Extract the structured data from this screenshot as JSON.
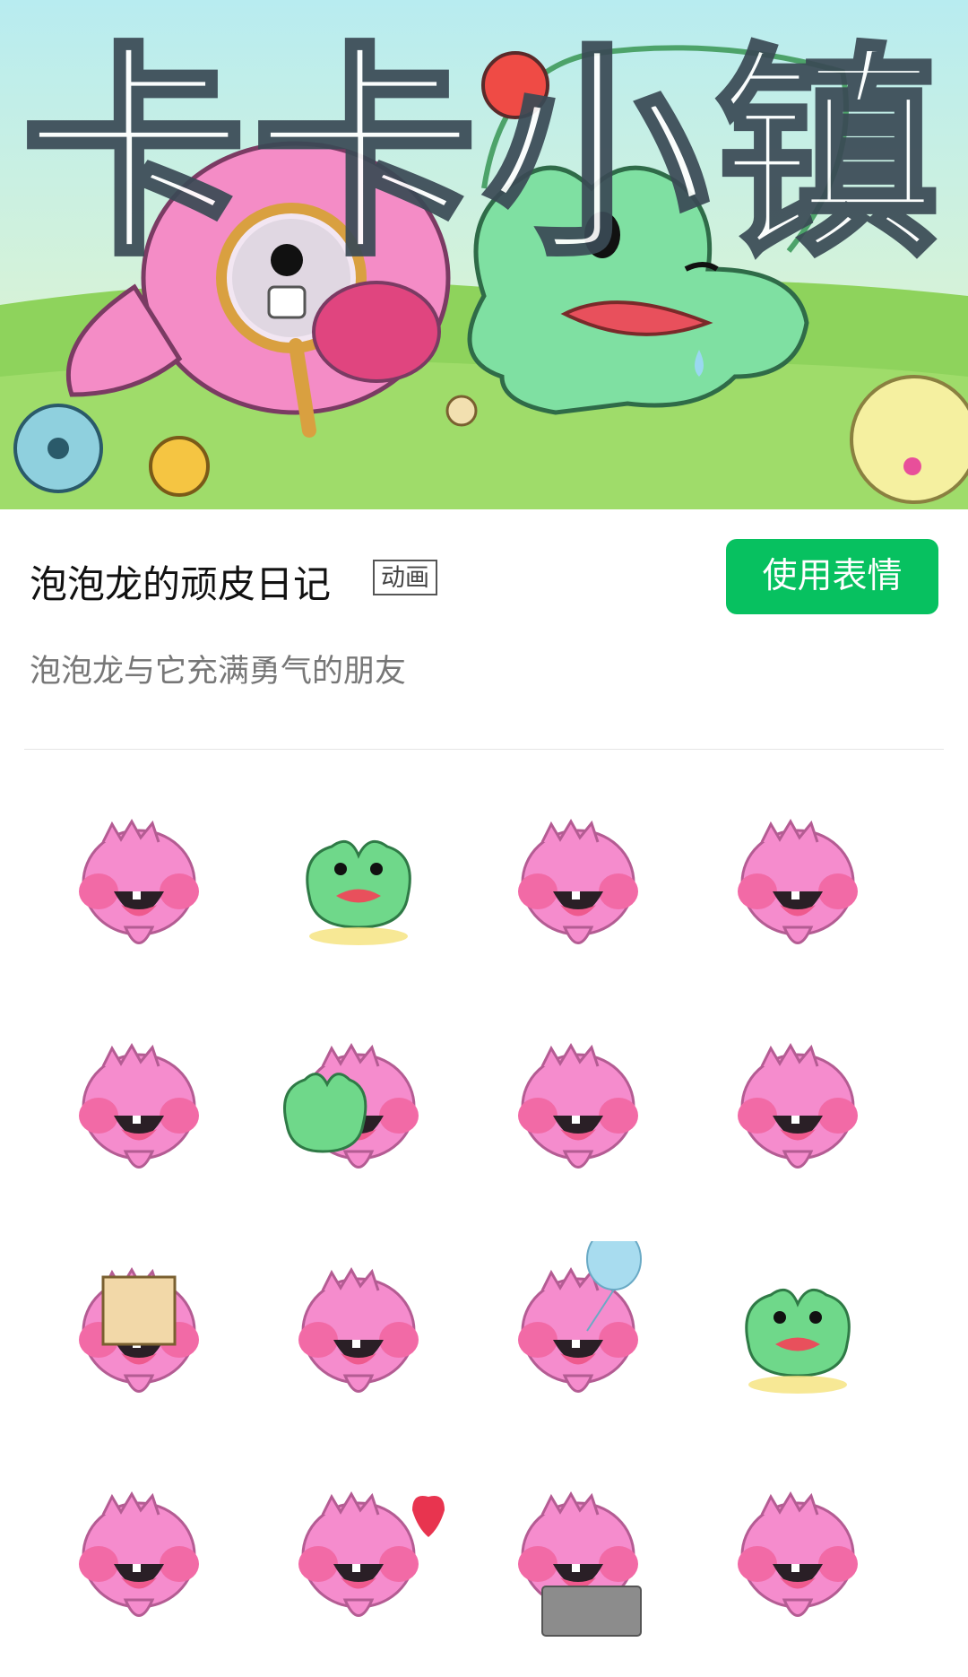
{
  "banner": {
    "title_art": "卡卡小镇",
    "colors": {
      "sky_top": "#b8ecf0",
      "sky_bottom": "#eaf7c8",
      "grass": "#8ed35c",
      "pink": "#f48cc6",
      "green": "#7fe0a2"
    }
  },
  "pack": {
    "title": "泡泡龙的顽皮日记",
    "tag": "动画",
    "use_button": "使用表情",
    "description": "泡泡龙与它充满勇气的朋友"
  },
  "colors": {
    "accent": "#07c160",
    "pink_dragon": "#f58ccd",
    "green_frog": "#6fd88a"
  },
  "stickers": [
    {
      "character": "pink-dragon",
      "pose": "laughing-lying"
    },
    {
      "character": "green-frog",
      "pose": "sitting-with-apple"
    },
    {
      "character": "pink-dragon",
      "pose": "peeking"
    },
    {
      "character": "pink-dragon",
      "pose": "shaking-laugh"
    },
    {
      "character": "pink-dragon",
      "pose": "laughing-with-fork"
    },
    {
      "character": "dragon-and-frog",
      "pose": "hugging"
    },
    {
      "character": "pink-dragon",
      "pose": "waving"
    },
    {
      "character": "pink-dragon",
      "pose": "cheering"
    },
    {
      "character": "pink-dragon",
      "pose": "holding-sign"
    },
    {
      "character": "pink-dragon",
      "pose": "singing"
    },
    {
      "character": "pink-dragon",
      "pose": "with-balloon"
    },
    {
      "character": "green-frog",
      "pose": "lying-down"
    },
    {
      "character": "pink-dragon",
      "pose": "falling"
    },
    {
      "character": "pink-dragon",
      "pose": "with-heart"
    },
    {
      "character": "pink-dragon",
      "pose": "with-laptop"
    },
    {
      "character": "pink-dragon",
      "pose": "shouting-ah"
    }
  ]
}
